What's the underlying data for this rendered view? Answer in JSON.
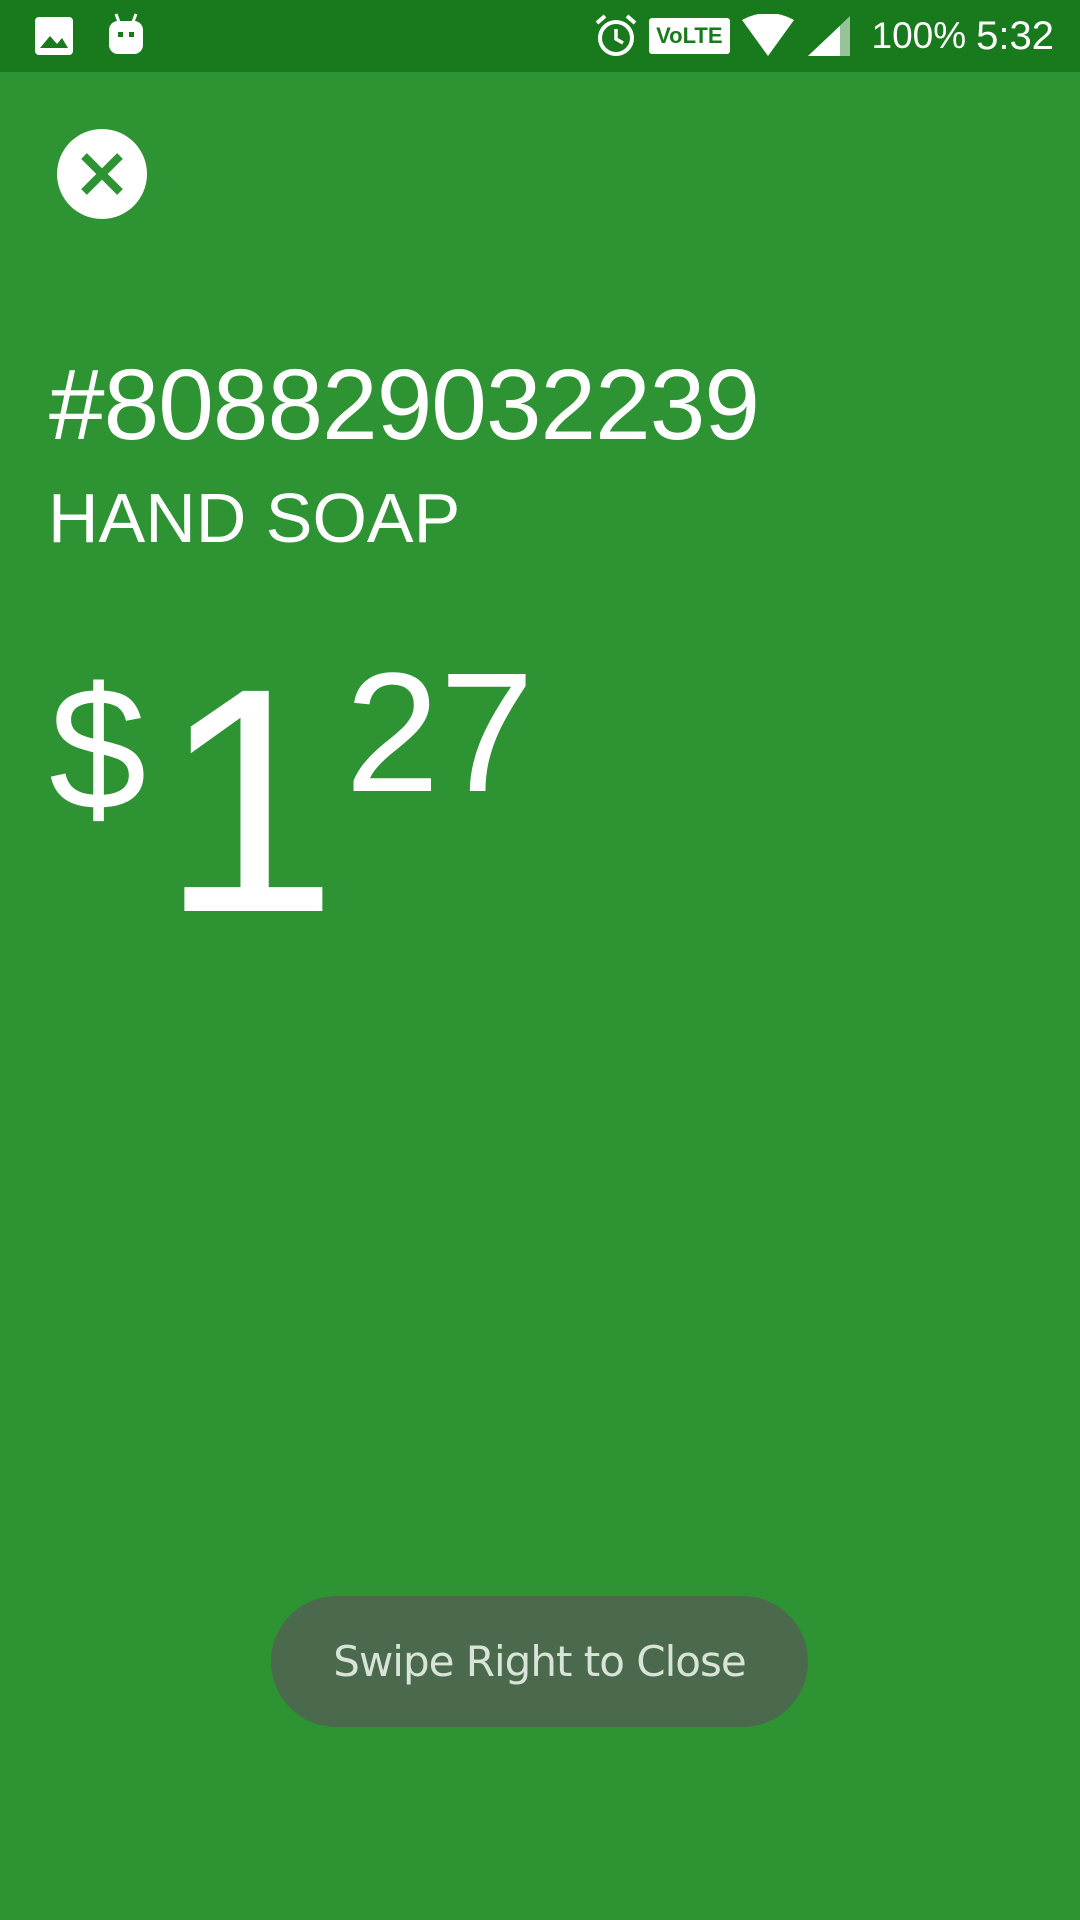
{
  "status_bar": {
    "battery": "100%",
    "time": "5:32",
    "network_badge": "VoLTE",
    "icons": [
      "image-icon",
      "android-debug-icon",
      "alarm-icon",
      "volte-icon",
      "wifi-icon",
      "cell-signal-icon"
    ]
  },
  "item": {
    "number": "#808829032239",
    "name": "HAND SOAP"
  },
  "price": {
    "currency_symbol": "$",
    "dollars": "1",
    "cents": "27"
  },
  "toast": {
    "message": "Swipe Right to Close"
  },
  "colors": {
    "background": "#2e9333",
    "status_bar": "#187a1c",
    "toast_background": "#4b6a4d",
    "text": "#ffffff"
  }
}
